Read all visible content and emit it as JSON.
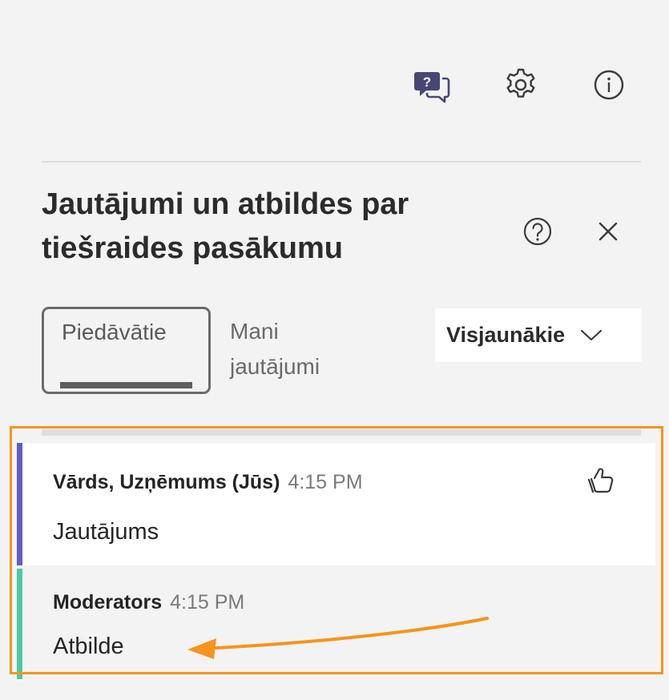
{
  "toolbar": {
    "icons": [
      "qa-icon",
      "settings-icon",
      "info-icon"
    ],
    "accent_color": "#464775"
  },
  "panel": {
    "title_line1": "Jautājumi un atbildes par",
    "title_line2": "tiešraides pasākumu"
  },
  "tabs": {
    "featured": "Piedāvātie",
    "mine_line1": "Mani",
    "mine_line2": "jautājumi"
  },
  "sort": {
    "selected": "Visjaunākie"
  },
  "question": {
    "author": "Vārds, Uzņēmums (Jūs)",
    "time": "4:15 PM",
    "text": "Jautājums",
    "bar_color": "#5b5fc7"
  },
  "answer": {
    "author": "Moderators",
    "time": "4:15 PM",
    "text": "Atbilde",
    "bar_color": "#4ec9a5"
  },
  "annotation": {
    "highlight_color": "#f7941d"
  }
}
